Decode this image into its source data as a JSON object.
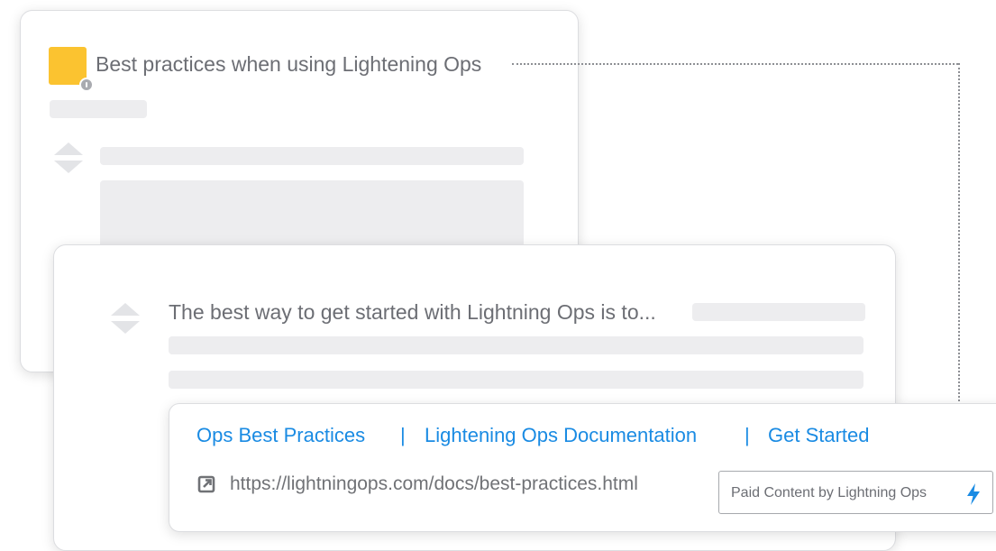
{
  "back_card": {
    "title": "Best practices when using Lightening Ops"
  },
  "front_card": {
    "answer_text": "The best way to get started with Lightning Ops is to..."
  },
  "ad_card": {
    "links": [
      "Ops Best Practices",
      "Lightening Ops Documentation",
      "Get Started"
    ],
    "separator": "|",
    "url": "https://lightningops.com/docs/best-practices.html",
    "paid_label": "Paid Content by Lightning Ops"
  },
  "colors": {
    "link": "#1a8be3",
    "avatar": "#fbc330",
    "bolt": "#1a8be3",
    "placeholder": "#ededef",
    "text": "#6c6e74"
  },
  "icons": {
    "external_link": "external-link-icon",
    "bolt": "lightning-bolt-icon",
    "vote_up": "upvote-icon",
    "vote_down": "downvote-icon"
  }
}
